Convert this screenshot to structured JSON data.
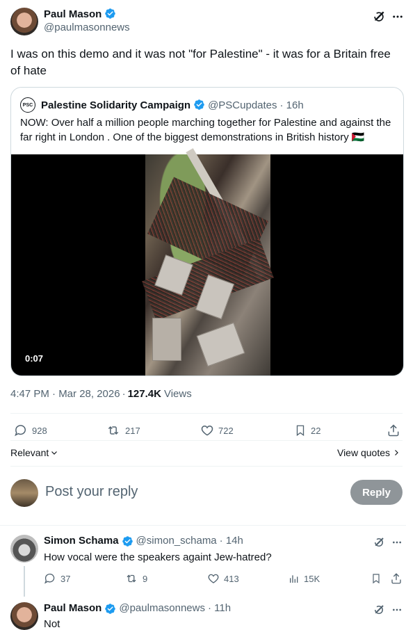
{
  "main_tweet": {
    "author_name": "Paul Mason",
    "author_handle": "@paulmasonnews",
    "text": "I was on this demo and it was not \"for Palestine\" - it was for a Britain free of hate",
    "timestamp": "4:47 PM · Mar 28, 2026",
    "views_count": "127.4K",
    "views_label": "Views",
    "stats": {
      "replies": "928",
      "reposts": "217",
      "likes": "722",
      "bookmarks": "22"
    }
  },
  "quoted_tweet": {
    "author_name": "Palestine Solidarity Campaign",
    "author_handle": "@PSCupdates",
    "age": "· 16h",
    "text": "NOW: Over half a million people marching together for Palestine and against the far right in London . One of the biggest demonstrations in British history 🇵🇸",
    "video_duration": "0:07",
    "logo_text": "PSC"
  },
  "sort": {
    "label": "Relevant",
    "view_quotes": "View quotes"
  },
  "composer": {
    "placeholder": "Post your reply",
    "button": "Reply"
  },
  "replies": [
    {
      "author_name": "Simon Schama",
      "author_handle": "@simon_schama",
      "age": "· 14h",
      "text": "How vocal were the speakers againt Jew-hatred?",
      "stats": {
        "replies": "37",
        "reposts": "9",
        "likes": "413",
        "views": "15K"
      }
    },
    {
      "author_name": "Paul Mason",
      "author_handle": "@paulmasonnews",
      "age": "· 11h",
      "text": "Not"
    }
  ],
  "colors": {
    "accent": "#1d9bf0",
    "text": "#0f1419",
    "muted": "#536471",
    "border": "#cfd9de"
  }
}
